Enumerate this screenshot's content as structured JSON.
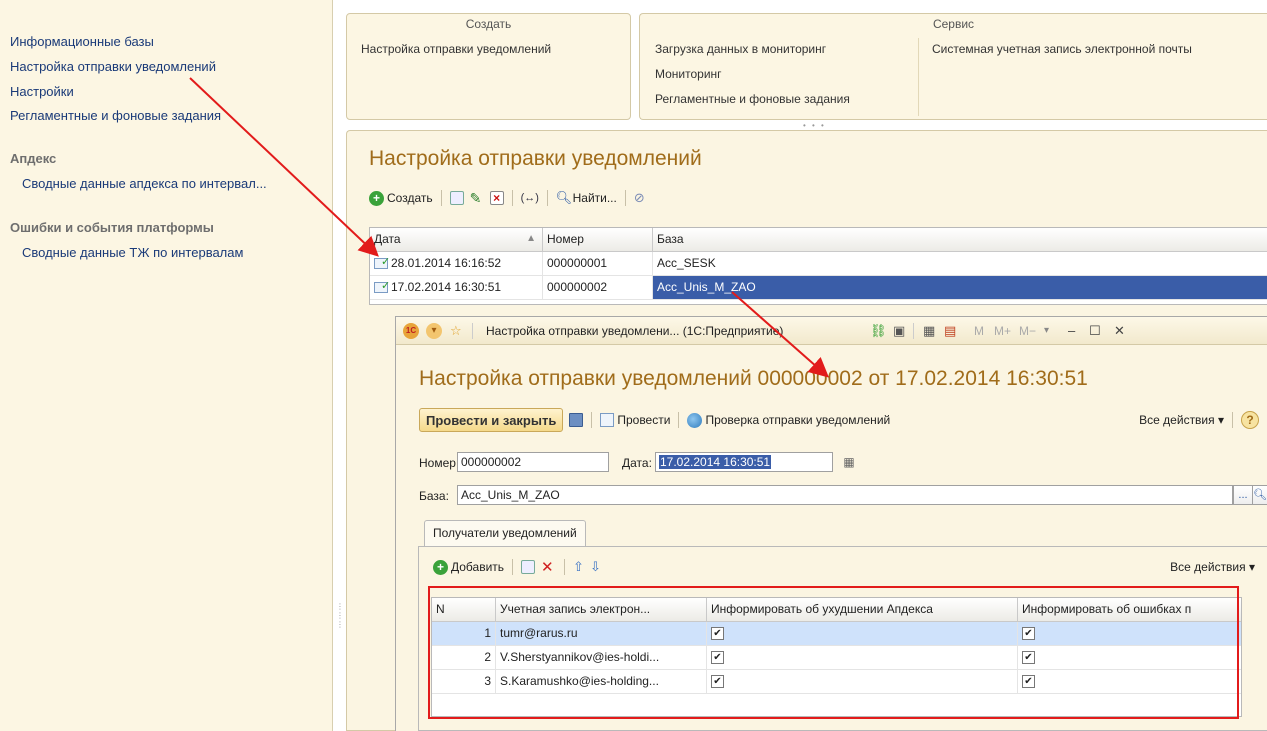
{
  "nav": {
    "links": [
      "Информационные базы",
      "Настройка отправки уведомлений",
      "Настройки",
      "Регламентные и фоновые задания"
    ],
    "groups": [
      {
        "title": "Апдекс",
        "items": [
          "Сводные данные апдекса по интервал..."
        ]
      },
      {
        "title": "Ошибки и события платформы",
        "items": [
          "Сводные данные ТЖ по интервалам"
        ]
      }
    ]
  },
  "command_panel": {
    "create": {
      "title": "Создать",
      "items": [
        "Настройка отправки уведомлений"
      ]
    },
    "service": {
      "title": "Сервис",
      "col1": [
        "Загрузка данных в мониторинг",
        "Мониторинг",
        "Регламентные и фоновые задания"
      ],
      "col2": [
        "Системная учетная запись электронной почты"
      ]
    }
  },
  "list_form": {
    "title": "Настройка отправки уведомлений",
    "toolbar": {
      "create": "Создать",
      "find": "Найти..."
    },
    "columns": [
      "Дата",
      "Номер",
      "База"
    ],
    "rows": [
      {
        "date": "28.01.2014 16:16:52",
        "number": "000000001",
        "base": "Acc_SESK"
      },
      {
        "date": "17.02.2014 16:30:51",
        "number": "000000002",
        "base": "Acc_Unis_M_ZAO"
      }
    ]
  },
  "doc_window": {
    "titlebar": "Настройка отправки уведомлени... (1С:Предприятие)",
    "title": "Настройка отправки уведомлений 000000002 от 17.02.2014 16:30:51",
    "toolbar": {
      "post_close": "Провести и закрыть",
      "post": "Провести",
      "check": "Проверка отправки уведомлений",
      "all_actions": "Все действия ▾",
      "help": "?"
    },
    "fields": {
      "number_label": "Номер:",
      "number": "000000002",
      "date_label": "Дата:",
      "date": "17.02.2014 16:30:51",
      "base_label": "База:",
      "base": "Acc_Unis_M_ZAO"
    },
    "tab": "Получатели уведомлений",
    "table_toolbar": {
      "add": "Добавить",
      "all_actions": "Все действия ▾"
    },
    "columns": [
      "N",
      "Учетная запись электрон...",
      "Информировать об ухудшении Апдекса",
      "Информировать об ошибках п"
    ],
    "rows": [
      {
        "n": "1",
        "account": "tumr@rarus.ru",
        "apdex": true,
        "errors": true
      },
      {
        "n": "2",
        "account": "V.Sherstyannikov@ies-holdi...",
        "apdex": true,
        "errors": true
      },
      {
        "n": "3",
        "account": "S.Karamushko@ies-holding...",
        "apdex": true,
        "errors": true
      }
    ]
  },
  "colors": {
    "accent": "#a06c1a",
    "selection": "#3a5da8",
    "row_highlight": "#cfe2fb",
    "annotation": "#e21b1b"
  }
}
